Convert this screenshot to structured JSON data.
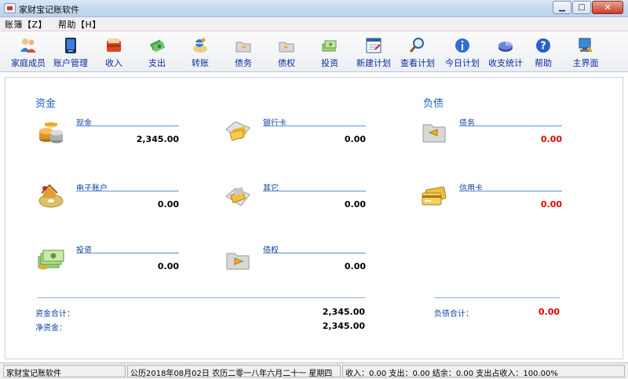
{
  "window": {
    "title": "家财宝记账软件"
  },
  "menu": [
    {
      "label": "账簿【Z】"
    },
    {
      "label": "帮助【H】"
    }
  ],
  "toolbar": [
    {
      "label": "家庭成员",
      "icon": "family-members-icon"
    },
    {
      "label": "账户管理",
      "icon": "account-manage-icon"
    },
    {
      "label": "收入",
      "icon": "income-icon"
    },
    {
      "label": "支出",
      "icon": "expense-icon"
    },
    {
      "label": "转账",
      "icon": "transfer-icon"
    },
    {
      "label": "债务",
      "icon": "debt-icon"
    },
    {
      "label": "债权",
      "icon": "credit-icon"
    },
    {
      "label": "投资",
      "icon": "investment-icon"
    },
    {
      "label": "新建计划",
      "icon": "new-plan-icon"
    },
    {
      "label": "查看计划",
      "icon": "view-plan-icon"
    },
    {
      "label": "今日计划",
      "icon": "today-plan-icon"
    },
    {
      "label": "收支统计",
      "icon": "statistics-icon"
    },
    {
      "label": "帮助",
      "icon": "help-icon"
    },
    {
      "label": "主界面",
      "icon": "main-screen-icon"
    }
  ],
  "assets": {
    "title": "资金",
    "items": [
      {
        "name": "现金",
        "amount": "2,345.00",
        "icon": "coins-icon"
      },
      {
        "name": "银行卡",
        "amount": "0.00",
        "icon": "bank-card-icon"
      },
      {
        "name": "电子账户",
        "amount": "0.00",
        "icon": "e-account-icon"
      },
      {
        "name": "其它",
        "amount": "0.00",
        "icon": "other-icon"
      },
      {
        "name": "投资",
        "amount": "0.00",
        "icon": "investment-money-icon"
      },
      {
        "name": "债权",
        "amount": "0.00",
        "icon": "credit-claim-icon"
      }
    ],
    "total_label": "资金合计：",
    "total_value": "2,345.00",
    "net_label": "净资金：",
    "net_value": "2,345.00"
  },
  "liabilities": {
    "title": "负债",
    "items": [
      {
        "name": "债务",
        "amount": "0.00",
        "icon": "debt-folder-icon"
      },
      {
        "name": "信用卡",
        "amount": "0.00",
        "icon": "credit-card-icon"
      }
    ],
    "total_label": "负债合计：",
    "total_value": "0.00"
  },
  "status": {
    "app": "家财宝记账软件",
    "date": "公历2018年08月02日  农历二零一八年六月二十一  星期四",
    "summary": "收入：0.00 支出：0.00 结余：0.00 支出占收入：100.00%"
  },
  "colors": {
    "accent": "#1a5fc4",
    "label": "#0b3f9c",
    "negative": "#e00000",
    "line": "#5b8fd6"
  }
}
